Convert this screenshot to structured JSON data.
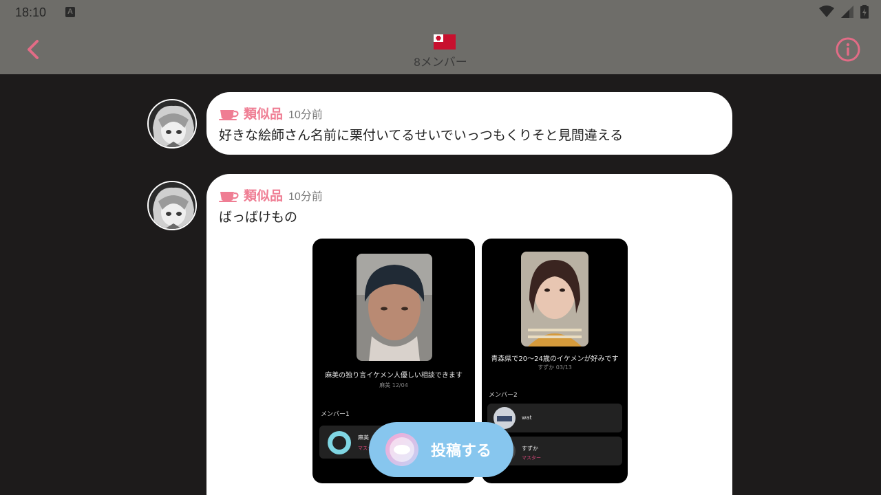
{
  "status_bar": {
    "time": "18:10",
    "a_icon": "A",
    "icons": [
      "wifi-icon",
      "signal-icon",
      "battery-icon"
    ]
  },
  "header": {
    "flag": "tonga-flag-icon",
    "members": "8メンバー",
    "back_icon": "chevron-left-icon",
    "info_icon": "info-icon"
  },
  "colors": {
    "accent": "#ef7d93",
    "post_button": "#87c6ee",
    "header_bg": "#6e6d69",
    "page_bg": "#1d1b1b"
  },
  "messages": [
    {
      "author": "類似品",
      "time_ago": "10分前",
      "text": "好きな絵師さん名前に栗付いてるせいでいっつもくりそと見間違える"
    },
    {
      "author": "類似品",
      "time_ago": "10分前",
      "text": "ばっばけもの",
      "screenshots": [
        {
          "caption": "麻美の独り言イケメン人優しい相談できます",
          "sub": "麻美 12/04",
          "section": "メンバー1",
          "rows": [
            {
              "title": "麻美",
              "sub": "マスター"
            }
          ]
        },
        {
          "caption": "青森県で20〜24歳のイケメンが好みです",
          "sub": "すずか 03/13",
          "section": "メンバー2",
          "rows": [
            {
              "title": "wat",
              "sub": ""
            },
            {
              "title": "すずか",
              "sub": "マスター"
            }
          ]
        }
      ]
    }
  ],
  "post_button": {
    "label": "投稿する"
  }
}
